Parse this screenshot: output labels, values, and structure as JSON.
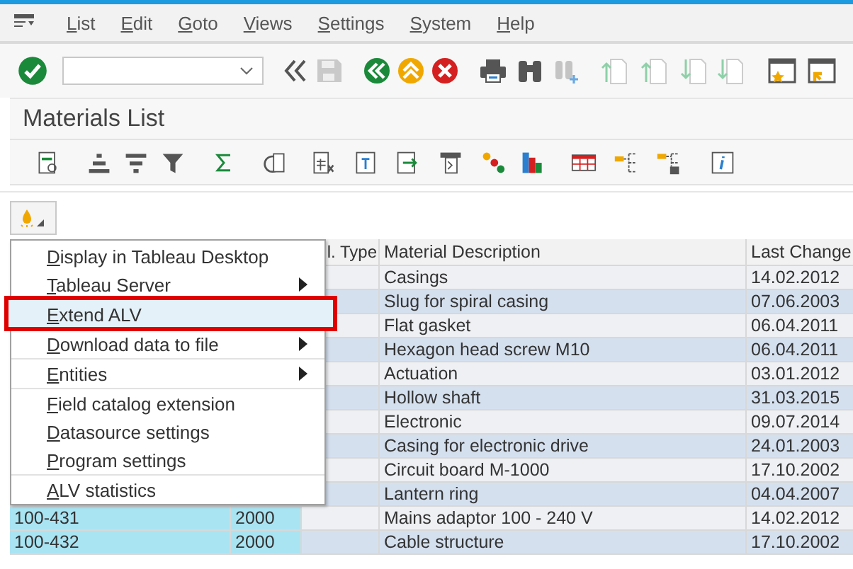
{
  "menu_bar": [
    "List",
    "Edit",
    "Goto",
    "Views",
    "Settings",
    "System",
    "Help"
  ],
  "title": "Materials List",
  "context_menu": [
    {
      "label": "Display in Tableau Desktop",
      "submenu": false,
      "selected": false,
      "separator_before": false
    },
    {
      "label": "Tableau Server",
      "submenu": true,
      "selected": false,
      "separator_before": false
    },
    {
      "label": "Extend ALV",
      "submenu": false,
      "selected": true,
      "separator_before": true
    },
    {
      "label": "Download data to file",
      "submenu": true,
      "selected": false,
      "separator_before": true
    },
    {
      "label": "Entities",
      "submenu": true,
      "selected": false,
      "separator_before": true
    },
    {
      "label": "Field catalog extension",
      "submenu": false,
      "selected": false,
      "separator_before": true
    },
    {
      "label": "Datasource settings",
      "submenu": false,
      "selected": false,
      "separator_before": false
    },
    {
      "label": "Program settings",
      "submenu": false,
      "selected": false,
      "separator_before": false
    },
    {
      "label": "ALV statistics",
      "submenu": false,
      "selected": false,
      "separator_before": true
    }
  ],
  "table": {
    "columns": [
      "l. Type",
      "Material Description",
      "Last Change"
    ],
    "rows": [
      {
        "description": "Casings",
        "last_change": "14.02.2012"
      },
      {
        "description": "Slug for spiral casing",
        "last_change": "07.06.2003"
      },
      {
        "description": "Flat gasket",
        "last_change": "06.04.2011"
      },
      {
        "description": "Hexagon head screw M10",
        "last_change": "06.04.2011"
      },
      {
        "description": "Actuation",
        "last_change": "03.01.2012"
      },
      {
        "description": "Hollow shaft",
        "last_change": "31.03.2015"
      },
      {
        "description": "Electronic",
        "last_change": "09.07.2014"
      },
      {
        "description": "Casing for electronic drive",
        "last_change": "24.01.2003"
      },
      {
        "description": "Circuit board M-1000",
        "last_change": "17.10.2002"
      },
      {
        "description": "Lantern ring",
        "last_change": "04.04.2007"
      },
      {
        "material": "100-431",
        "plant": "2000",
        "description": "Mains adaptor 100 - 240 V",
        "last_change": "14.02.2012"
      },
      {
        "material": "100-432",
        "plant": "2000",
        "description": "Cable structure",
        "last_change": "17.10.2002"
      }
    ]
  }
}
